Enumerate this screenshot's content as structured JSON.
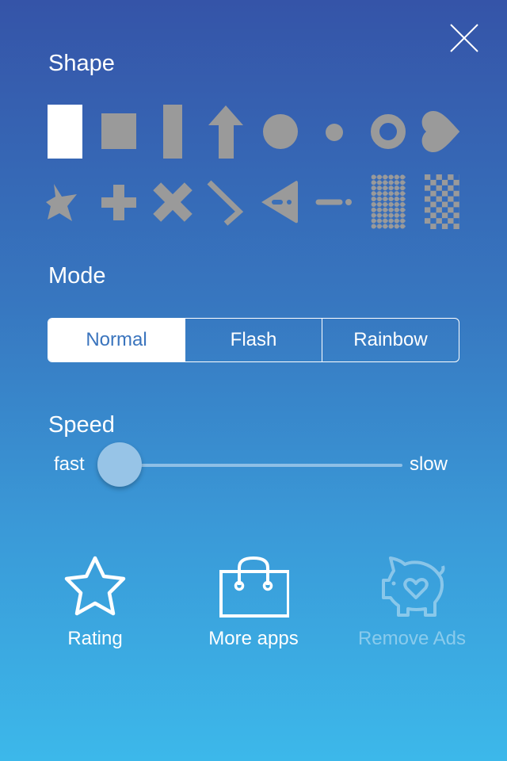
{
  "close_icon": "close-icon",
  "shape": {
    "title": "Shape",
    "selected_index": 0,
    "items": [
      "tall-rectangle",
      "square",
      "thin-bar",
      "arrow-up",
      "large-circle",
      "small-dot",
      "ring",
      "heart",
      "star",
      "plus",
      "cross",
      "chevron",
      "triangle-marker",
      "dash-dot",
      "dot-grid",
      "checkerboard"
    ]
  },
  "mode": {
    "title": "Mode",
    "options": [
      "Normal",
      "Flash",
      "Rainbow"
    ],
    "selected": "Normal"
  },
  "speed": {
    "title": "Speed",
    "min_label": "fast",
    "max_label": "slow",
    "value": 0
  },
  "actions": [
    {
      "label": "Rating",
      "icon": "star-icon",
      "enabled": true
    },
    {
      "label": "More apps",
      "icon": "shopping-bag-icon",
      "enabled": true
    },
    {
      "label": "Remove Ads",
      "icon": "piggy-bank-icon",
      "enabled": false
    }
  ],
  "colors": {
    "shape_gray": "#9a9a9a",
    "selected": "#ffffff",
    "accent_text": "#3a74bd"
  }
}
